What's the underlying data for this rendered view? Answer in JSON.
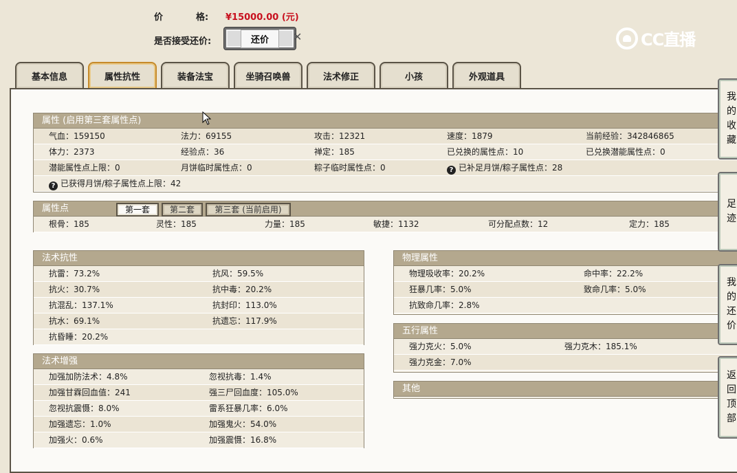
{
  "header": {
    "price_label_a": "价",
    "price_label_b": "格:",
    "price_value": "¥15000.00 (元)",
    "haggle_label": "是否接受还价:",
    "haggle_button": "还价",
    "logo_text": "CC直播"
  },
  "tabs": [
    "基本信息",
    "属性抗性",
    "装备法宝",
    "坐骑召唤兽",
    "法术修正",
    "小孩",
    "外观道具"
  ],
  "attributes": {
    "title": "属性 (启用第三套属性点)",
    "rows": [
      [
        "气血：159150",
        "法力：69155",
        "攻击：12321",
        "速度：1879",
        "当前经验：342846865"
      ],
      [
        "体力：2373",
        "经验点：36",
        "禅定：185",
        "已兑换的属性点：10",
        "已兑换潜能属性点：0"
      ],
      [
        "潜能属性点上限：0",
        "月饼临时属性点：0",
        "粽子临时属性点：0",
        "已补足月饼/粽子属性点：28",
        ""
      ],
      [
        "已获得月饼/粽子属性点上限：42",
        "",
        "",
        "",
        ""
      ]
    ]
  },
  "points": {
    "title": "属性点",
    "subtabs": [
      "第一套",
      "第二套",
      "第三套 (当前启用)"
    ],
    "row": [
      "根骨：185",
      "灵性：185",
      "力量：185",
      "敏捷：1132",
      "可分配点数：12",
      "定力：185"
    ]
  },
  "spell_resist": {
    "title": "法术抗性",
    "rows": [
      [
        "抗雷：73.2%",
        "抗风：59.5%"
      ],
      [
        "抗火：30.7%",
        "抗中毒：20.2%"
      ],
      [
        "抗混乱：137.1%",
        "抗封印：113.0%"
      ],
      [
        "抗水：69.1%",
        "抗遗忘：117.9%"
      ],
      [
        "抗昏睡：20.2%",
        ""
      ]
    ]
  },
  "spell_boost": {
    "title": "法术增强",
    "rows": [
      [
        "加强加防法术：4.8%",
        "忽视抗毒：1.4%"
      ],
      [
        "加强甘霖回血值：241",
        "强三尸回血度：105.0%"
      ],
      [
        "忽视抗震慑：8.0%",
        "雷系狂暴几率：6.0%"
      ],
      [
        "加强遗忘：1.0%",
        "加强鬼火：54.0%"
      ],
      [
        "加强火：0.6%",
        "加强震慑：16.8%"
      ]
    ]
  },
  "physical": {
    "title": "物理属性",
    "rows": [
      [
        "物理吸收率：20.2%",
        "命中率：22.2%"
      ],
      [
        "狂暴几率：5.0%",
        "致命几率：5.0%"
      ],
      [
        "抗致命几率：2.8%",
        ""
      ]
    ]
  },
  "five_elements": {
    "title": "五行属性",
    "rows": [
      [
        "强力克火：5.0%",
        "强力克木：185.1%"
      ],
      [
        "强力克金：7.0%",
        ""
      ]
    ]
  },
  "other": {
    "title": "其他"
  },
  "side": {
    "favorites": [
      "我",
      "的",
      "收",
      "藏"
    ],
    "footprint": [
      "足",
      "迹"
    ],
    "my_offers": [
      "我",
      "的",
      "还",
      "价"
    ],
    "back_top": [
      "返",
      "回",
      "顶",
      "部"
    ]
  }
}
